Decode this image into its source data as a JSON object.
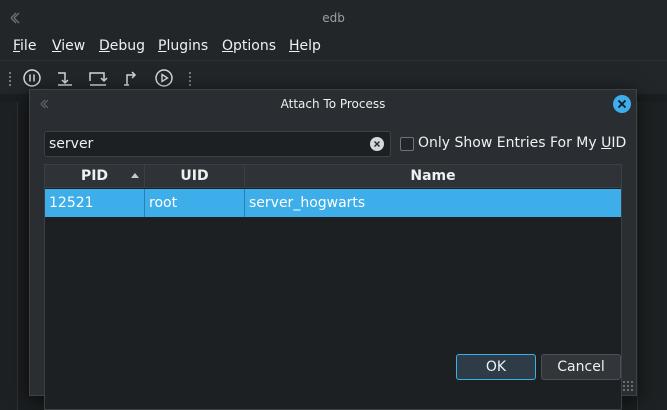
{
  "window": {
    "title": "edb"
  },
  "menu": [
    {
      "label_ul": "F",
      "label_rest": "ile"
    },
    {
      "label_ul": "V",
      "label_rest": "iew"
    },
    {
      "label_ul": "D",
      "label_rest": "ebug"
    },
    {
      "label_ul": "P",
      "label_rest": "lugins"
    },
    {
      "label_ul": "O",
      "label_rest": "ptions"
    },
    {
      "label_ul": "H",
      "label_rest": "elp"
    }
  ],
  "toolbar": {
    "icons": [
      "pause-icon",
      "step-into-icon",
      "step-over-icon",
      "step-out-icon",
      "run-icon"
    ]
  },
  "dialog": {
    "title": "Attach To Process",
    "filter_value": "server",
    "checkbox_label_pre": "Only Show Entries For My ",
    "checkbox_label_ul": "U",
    "checkbox_label_post": "ID",
    "checkbox_checked": false,
    "columns": [
      "PID",
      "UID",
      "Name"
    ],
    "rows": [
      {
        "pid": "12521",
        "uid": "root",
        "name": "server_hogwarts"
      }
    ],
    "ok_label": "OK",
    "cancel_label": "Cancel"
  },
  "colors": {
    "accent": "#3daee9",
    "background": "#232629"
  }
}
